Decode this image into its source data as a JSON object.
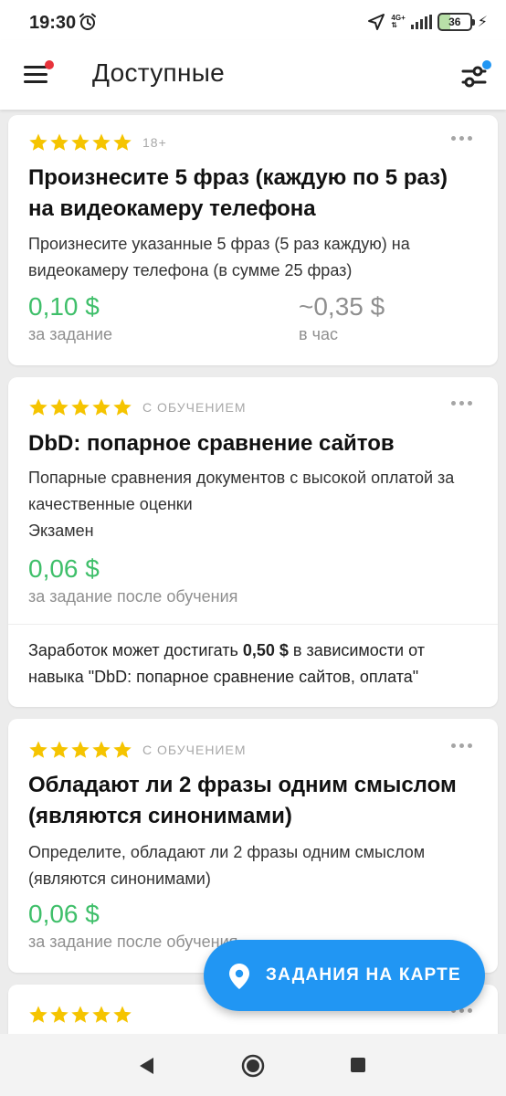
{
  "status_bar": {
    "time": "19:30",
    "network_label": "4G+",
    "battery_level": "36",
    "icons": [
      "alarm-icon",
      "location-icon",
      "signal-icon",
      "battery-icon",
      "charging-icon"
    ]
  },
  "header": {
    "title": "Доступные",
    "menu_has_notification": true,
    "filter_has_notification": true,
    "icons": [
      "menu-icon",
      "filter-icon"
    ]
  },
  "colors": {
    "accent": "#2196f3",
    "price_green": "#3fbf6a",
    "star_yellow": "#f5c400",
    "notification_red": "#e8333b"
  },
  "tasks": [
    {
      "rating": 5,
      "badge": "18+",
      "title": "Произнесите 5 фраз (каждую по 5 раз) на видеокамеру телефона",
      "description": "Произнесите указанные 5 фраз (5 раз каждую) на видеокамеру телефона (в сумме 25 фраз)",
      "price": "0,10 $",
      "price_label": "за задание",
      "hourly_rate": "~0,35 $",
      "hourly_label": "в час"
    },
    {
      "rating": 5,
      "badge": "С ОБУЧЕНИЕМ",
      "title": "DbD: попарное сравнение сайтов",
      "description": "Попарные сравнения документов с высокой оплатой за качественные оценки",
      "extra": "Экзамен",
      "price": "0,06 $",
      "price_label": "за задание после обучения",
      "earn_prefix": "Заработок может достигать ",
      "earn_amount": "0,50 $",
      "earn_suffix": " в зависимости от навыка \"DbD: попарное сравнение сайтов, оплата\""
    },
    {
      "rating": 5,
      "badge": "С ОБУЧЕНИЕМ",
      "title": "Обладают ли 2 фразы одним смыслом (являются синонимами)",
      "description": "Определите, обладают ли 2 фразы одним смыслом (являются синонимами)",
      "price": "0,06 $",
      "price_label": "за задание после обучения"
    },
    {
      "rating": 5
    }
  ],
  "fab": {
    "label": "ЗАДАНИЯ НА КАРТЕ",
    "icon": "map-pin-icon"
  },
  "nav_bar": {
    "icons": [
      "back-icon",
      "home-icon",
      "recents-icon"
    ]
  }
}
